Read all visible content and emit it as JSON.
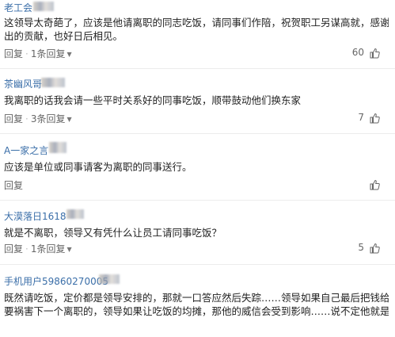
{
  "comments": [
    {
      "username": "老工会",
      "text_lines": [
        "这领导太奇葩了，应该是他请离职的同志吃饭，请同事们作陪，祝贺职工另谋高就，感谢职工为企业做出",
        "出的贡献，也好日后相见。"
      ],
      "reply_label": "回复",
      "replies_label": "1条回复",
      "likes": "60"
    },
    {
      "username": "茶幽风哥",
      "text_lines": [
        "我离职的话我会请一些平时关系好的同事吃饭，顺带鼓动他们换东家"
      ],
      "reply_label": "回复",
      "replies_label": "3条回复",
      "likes": "7"
    },
    {
      "username": "A一家之言",
      "text_lines": [
        "应该是单位或同事请客为离职的同事送行。"
      ],
      "reply_label": "回复",
      "replies_label": "",
      "likes": ""
    },
    {
      "username": "大漠落日1618",
      "text_lines": [
        "就是不离职，领导又有凭什么让员工请同事吃饭？"
      ],
      "reply_label": "回复",
      "replies_label": "1条回复",
      "likes": "5"
    },
    {
      "username": "手机用户59860270005",
      "text_lines": [
        "既然请吃饭，定价都是领导安排的，那就一口答应然后失踪……领导如果自己最后把钱给了，就会让他不",
        "要祸害下一个离职的，领导如果让吃饭的均摊，那他的威信会受到影响……说不定他就是下一个离职者"
      ],
      "reply_label": "",
      "replies_label": "",
      "likes": ""
    }
  ]
}
